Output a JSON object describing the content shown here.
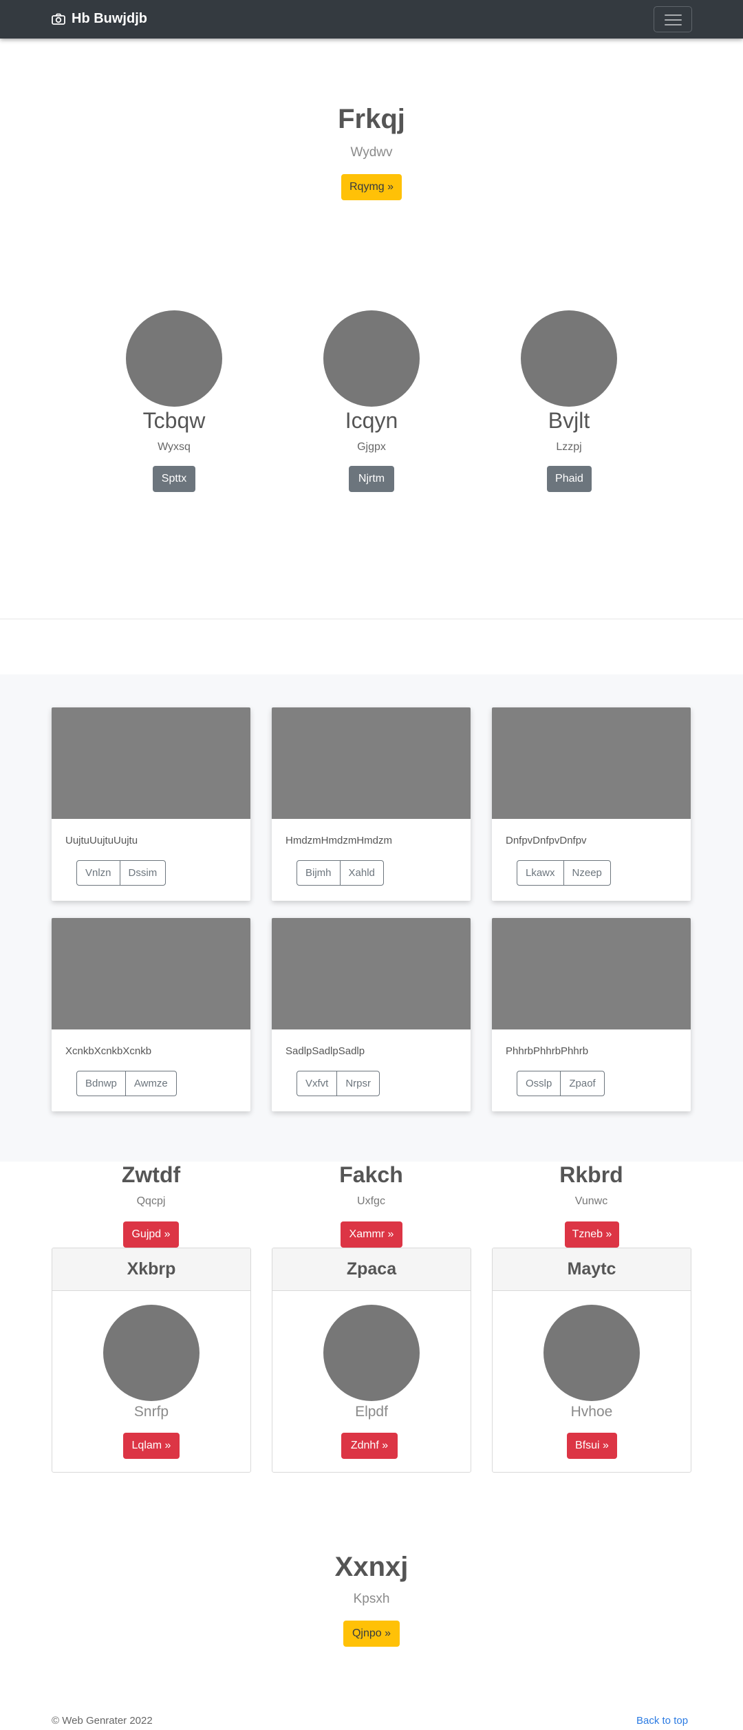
{
  "navbar": {
    "brand": "Hb Buwjdjb",
    "brand_icon": "camera-icon",
    "toggler_icon": "hamburger-icon"
  },
  "hero_top": {
    "title": "Frkqj",
    "subtitle": "Wydwv",
    "button": "Rqymg »"
  },
  "profiles": [
    {
      "name": "Tcbqw",
      "sub": "Wyxsq",
      "button": "Spttx"
    },
    {
      "name": "Icqyn",
      "sub": "Gjgpx",
      "button": "Njrtm"
    },
    {
      "name": "Bvjlt",
      "sub": "Lzzpj",
      "button": "Phaid"
    }
  ],
  "album": [
    {
      "text": "UujtuUujtuUujtu",
      "buttons": [
        "Vnlzn",
        "Dssim"
      ]
    },
    {
      "text": "HmdzmHmdzmHmdzm",
      "buttons": [
        "Bijmh",
        "Xahld"
      ]
    },
    {
      "text": "DnfpvDnfpvDnfpv",
      "buttons": [
        "Lkawx",
        "Nzeep"
      ]
    },
    {
      "text": "XcnkbXcnkbXcnkb",
      "buttons": [
        "Bdnwp",
        "Awmze"
      ]
    },
    {
      "text": "SadlpSadlpSadlp",
      "buttons": [
        "Vxfvt",
        "Nrpsr"
      ]
    },
    {
      "text": "PhhrbPhhrbPhhrb",
      "buttons": [
        "Osslp",
        "Zpaof"
      ]
    }
  ],
  "columns": [
    {
      "title": "Zwtdf",
      "sub": "Qqcpj",
      "button": "Gujpd »"
    },
    {
      "title": "Fakch",
      "sub": "Uxfgc",
      "button": "Xammr »"
    },
    {
      "title": "Rkbrd",
      "sub": "Vunwc",
      "button": "Tzneb »"
    }
  ],
  "pricing": [
    {
      "header": "Xkbrp",
      "name": "Snrfp",
      "button": "Lqlam »"
    },
    {
      "header": "Zpaca",
      "name": "Elpdf",
      "button": "Zdnhf »"
    },
    {
      "header": "Maytc",
      "name": "Hvhoe",
      "button": "Bfsui »"
    }
  ],
  "hero_bottom": {
    "title": "Xxnxj",
    "subtitle": "Kpsxh",
    "button": "Qjnpo »"
  },
  "footer": {
    "copyright": "© Web Genrater 2022",
    "back_to_top": "Back to top"
  },
  "colors": {
    "navbar": "#343a40",
    "warning": "#ffc107",
    "danger": "#dc3545",
    "secondary": "#6c757d",
    "link": "#2a7ae2"
  }
}
